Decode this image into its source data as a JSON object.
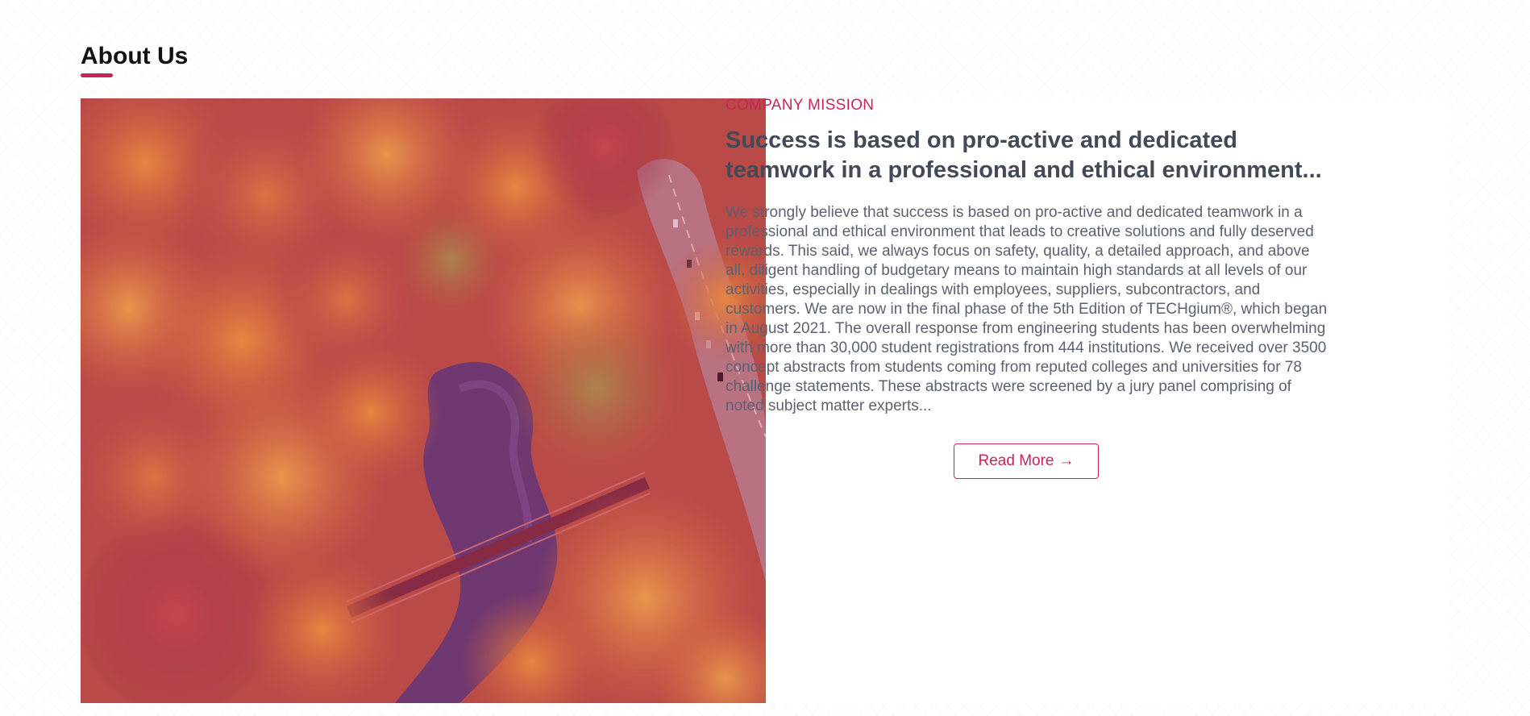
{
  "section": {
    "title": "About Us"
  },
  "photo": {
    "description": "aerial-autumn-forest-river-bridge-road"
  },
  "mission": {
    "eyebrow": "COMPANY MISSION",
    "headline": "Success is based on pro-active and dedicated teamwork in a professional and ethical environment...",
    "body": "We strongly believe that success is based on pro-active and dedicated teamwork in a professional and ethical environment that leads to creative solutions and fully deserved rewards. This said, we always focus on safety, quality, a detailed approach, and above all, diligent handling of budgetary means to maintain high standards at all levels of our activities, especially in dealings with employees, suppliers, subcontractors, and customers. We are now in the final phase of the 5th Edition of TECHgium®, which began in August 2021. The overall response from engineering students has been overwhelming with more than 30,000 student registrations from 444 institutions. We received over 3500 concept abstracts from students coming from reputed colleges and universities for 78 challenge statements. These abstracts were screened by a jury panel comprising of noted subject matter experts...",
    "read_more_label": "Read More",
    "read_more_icon": "arrow-right-icon",
    "read_more_arrow": "→"
  },
  "colors": {
    "accent": "#c9245a",
    "heading": "#434a57",
    "body": "#5b6270"
  }
}
